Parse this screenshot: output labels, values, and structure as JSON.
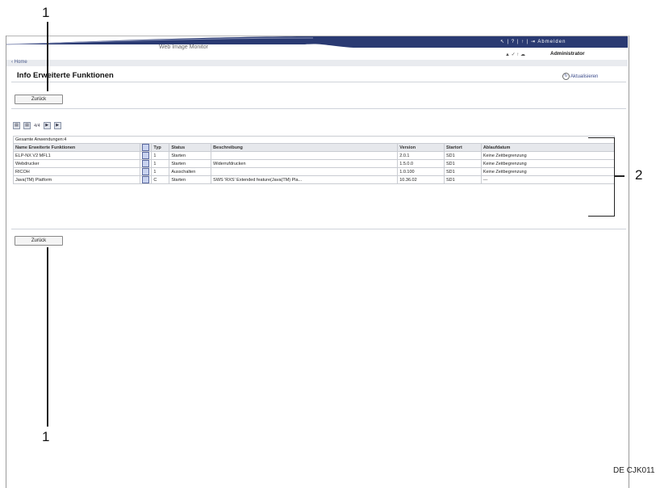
{
  "header": {
    "app_title": "Web Image Monitor",
    "top_icons": "↖ | ? | ↑ | ⇥ Abmelden",
    "sub_icons": "▲ ✓ ↑ ☁",
    "user": "Administrator",
    "colors": {
      "bar": "#2a3a72",
      "accent": "#e6e8ec"
    }
  },
  "nav": {
    "home": "‹ Home"
  },
  "page": {
    "title": "Info Erweiterte Funktionen",
    "refresh_label": "Aktualisieren",
    "back_label": "Zurück"
  },
  "toolbar": {
    "buttons": [
      "▤",
      "▤",
      "▶",
      "▶"
    ],
    "text": "4/4"
  },
  "table": {
    "caption": "Gesamte Anwendungen:4",
    "headers": [
      "Name Erweiterte Funktionen",
      "",
      "Typ",
      "Status",
      "Beschreibung",
      "Version",
      "Startort",
      "Ablaufdatum"
    ],
    "rows": [
      [
        "ELP-NX V2 MFL1",
        "1",
        "Starten",
        "",
        "2.0.1",
        "SD1",
        "Keine Zeitbegrenzung"
      ],
      [
        "Webdrucker",
        "1",
        "Starten",
        "Widerrufdrucken",
        "1.5.0.0",
        "SD1",
        "Keine Zeitbegrenzung"
      ],
      [
        "RICOH",
        "1",
        "Ausschalten",
        "",
        "1.0.100",
        "SD1",
        "Keine Zeitbegrenzung"
      ],
      [
        "Java(TM) Platform",
        "C",
        "Starten",
        "SWS 'RXS' Extended feature(Java(TM) Pla...",
        "10.36.02",
        "SD1",
        "---"
      ]
    ]
  },
  "annotations": {
    "callout_1": "1",
    "callout_2": "2",
    "code": "DE CJK011"
  }
}
